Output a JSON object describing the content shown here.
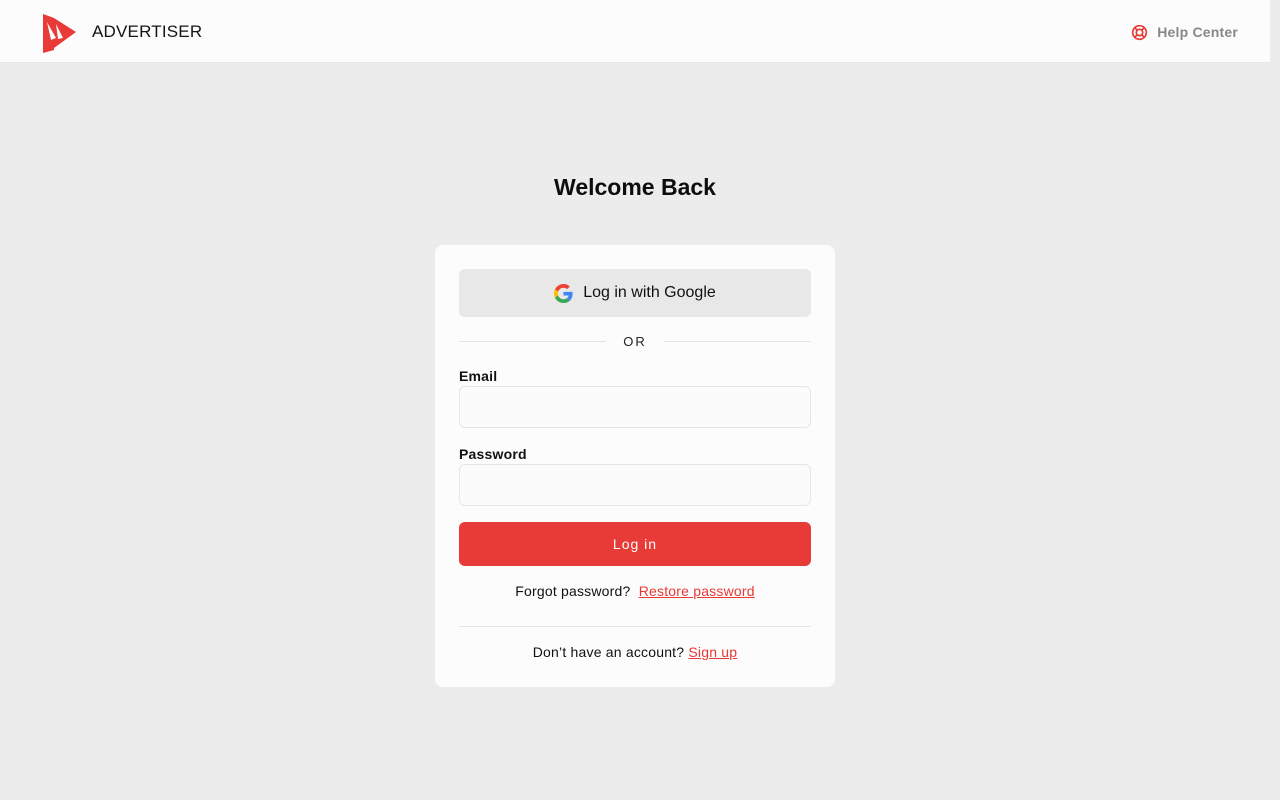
{
  "header": {
    "brand_name": "ADVERTISER",
    "help_label": "Help Center",
    "logo_icon": "play-logo-icon",
    "help_icon": "lifebuoy-icon"
  },
  "main": {
    "title": "Welcome Back"
  },
  "login_form": {
    "google_label": "Log in with Google",
    "google_icon": "google-icon",
    "divider_text": "OR",
    "email_label": "Email",
    "email_value": "",
    "password_label": "Password",
    "password_value": "",
    "login_label": "Log in",
    "forgot_text": "Forgot password?",
    "restore_label": "Restore password",
    "signup_text": "Don’t have an account?",
    "signup_label": "Sign up"
  },
  "colors": {
    "accent": "#e83a36",
    "page_bg": "#ececec",
    "card_bg": "#fcfcfc",
    "secondary_button_bg": "#e8e8e8",
    "muted_text": "#888888"
  }
}
